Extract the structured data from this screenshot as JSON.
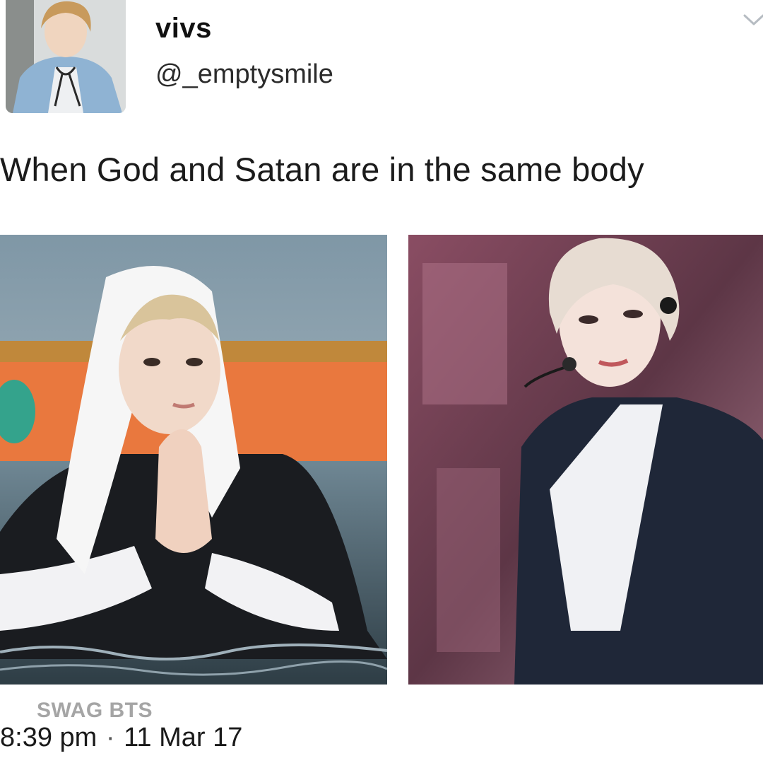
{
  "tweet": {
    "display_name": "vivs",
    "handle": "@_emptysmile",
    "text": "When God and Satan are in the same body",
    "time": "8:39 pm",
    "separator": "·",
    "date": "11 Mar 17"
  },
  "watermark": "SWAG BTS",
  "icons": {
    "menu": "chevron-down-icon"
  },
  "colors": {
    "background": "#ffffff",
    "text": "#111111",
    "watermark": "#a5a5a5",
    "chevron": "#b6bcc2"
  }
}
